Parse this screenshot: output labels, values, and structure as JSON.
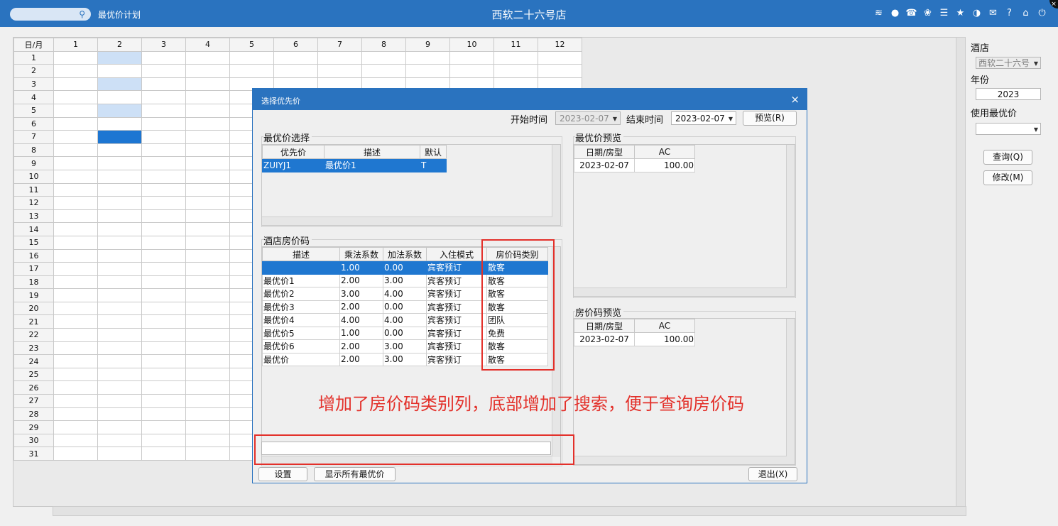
{
  "topbar": {
    "search_icon": "search-icon",
    "app_title": "最优价计划",
    "store_title": "西软二十六号店",
    "icons": [
      "wifi-icon",
      "chat-icon",
      "phone-icon",
      "palette-icon",
      "menu-icon",
      "star-icon",
      "theme-icon",
      "mail-icon",
      "help-icon",
      "home-icon",
      "power-icon"
    ],
    "close_glyph": "×"
  },
  "calendar": {
    "corner": "日/月",
    "months": [
      "1",
      "2",
      "3",
      "4",
      "5",
      "6",
      "7",
      "8",
      "9",
      "10",
      "11",
      "12"
    ],
    "days": [
      "1",
      "2",
      "3",
      "4",
      "5",
      "6",
      "7",
      "8",
      "9",
      "10",
      "11",
      "12",
      "13",
      "14",
      "15",
      "16",
      "17",
      "18",
      "19",
      "20",
      "21",
      "22",
      "23",
      "24",
      "25",
      "26",
      "27",
      "28",
      "29",
      "30",
      "31"
    ]
  },
  "side": {
    "hotel_label": "酒店",
    "hotel_value": "西软二十六号",
    "year_label": "年份",
    "year_value": "2023",
    "use_best_label": "使用最优价",
    "use_best_value": "",
    "query_button": "查询(Q)",
    "modify_button": "修改(M)"
  },
  "dialog": {
    "title": "选择优先价",
    "close": "×",
    "start_label": "开始时间",
    "start_value": "2023-02-07",
    "end_label": "结束时间",
    "end_value": "2023-02-07",
    "preview_button": "预览(R)",
    "best_select": {
      "title": "最优价选择",
      "columns": [
        "优先价",
        "描述",
        "默认"
      ],
      "rows": [
        [
          "ZUIYJ1",
          "最优价1",
          "T"
        ]
      ]
    },
    "hotel_rate": {
      "title": "酒店房价码",
      "columns": [
        "描述",
        "乘法系数",
        "加法系数",
        "入住模式",
        "房价码类别"
      ],
      "rows": [
        [
          "",
          "1.00",
          "0.00",
          "宾客预订",
          "散客"
        ],
        [
          "最优价1",
          "2.00",
          "3.00",
          "宾客预订",
          "散客"
        ],
        [
          "最优价2",
          "3.00",
          "4.00",
          "宾客预订",
          "散客"
        ],
        [
          "最优价3",
          "2.00",
          "0.00",
          "宾客预订",
          "散客"
        ],
        [
          "最优价4",
          "4.00",
          "4.00",
          "宾客预订",
          "团队"
        ],
        [
          "最优价5",
          "1.00",
          "0.00",
          "宾客预订",
          "免费"
        ],
        [
          "最优价6",
          "2.00",
          "3.00",
          "宾客预订",
          "散客"
        ],
        [
          "最优价",
          "2.00",
          "3.00",
          "宾客预订",
          "散客"
        ]
      ]
    },
    "best_preview": {
      "title": "最优价预览",
      "columns": [
        "日期/房型",
        "AC"
      ],
      "rows": [
        [
          "2023-02-07",
          "100.00"
        ]
      ]
    },
    "rate_preview": {
      "title": "房价码预览",
      "columns": [
        "日期/房型",
        "AC"
      ],
      "rows": [
        [
          "2023-02-07",
          "100.00"
        ]
      ]
    },
    "settings_button": "设置",
    "show_all_button": "显示所有最优价",
    "exit_button": "退出(X)"
  },
  "annotation": {
    "text": "增加了房价码类别列，底部增加了搜索，便于查询房价码",
    "color": "#e3302a"
  },
  "colors": {
    "accent": "#2a73bf",
    "selection": "#1f77d0",
    "highlight_light": "#cde0f6"
  }
}
